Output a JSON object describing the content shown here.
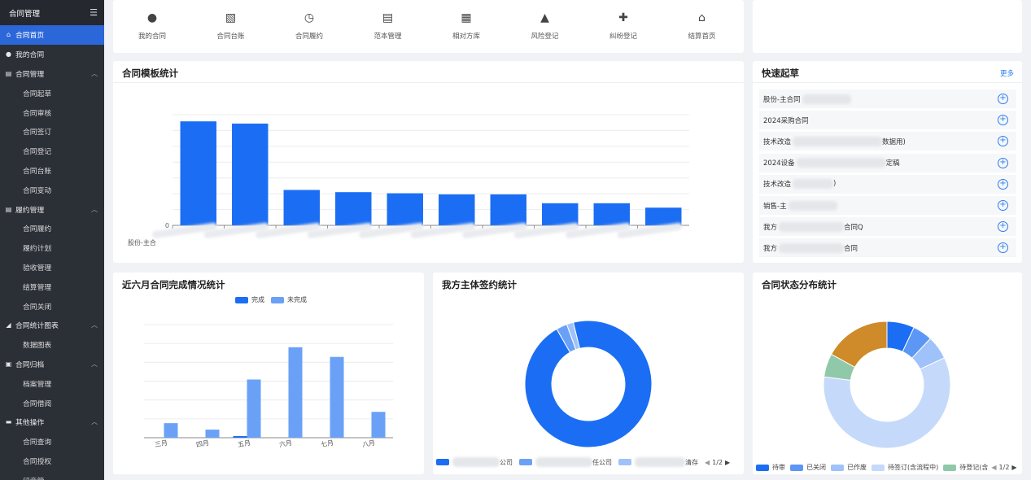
{
  "sidebar": {
    "title": "合同管理",
    "toggle_icon": "menu-fold-icon",
    "items": [
      {
        "label": "合同首页",
        "icon": "home-icon",
        "glyph": "⌂",
        "level": 1,
        "active": true
      },
      {
        "label": "我的合同",
        "icon": "user-icon",
        "glyph": "●",
        "level": 1
      },
      {
        "label": "合同管理",
        "icon": "doc-icon",
        "glyph": "▤",
        "level": 1,
        "expanded": true
      },
      {
        "label": "合同起草",
        "level": 2
      },
      {
        "label": "合同审核",
        "level": 2
      },
      {
        "label": "合同签订",
        "level": 2
      },
      {
        "label": "合同登记",
        "level": 2
      },
      {
        "label": "合同台账",
        "level": 2
      },
      {
        "label": "合同变动",
        "level": 2
      },
      {
        "label": "履约管理",
        "icon": "doc-icon",
        "glyph": "▤",
        "level": 1,
        "expanded": true
      },
      {
        "label": "合同履约",
        "level": 2
      },
      {
        "label": "履约计划",
        "level": 2
      },
      {
        "label": "验收管理",
        "level": 2
      },
      {
        "label": "结算管理",
        "level": 2
      },
      {
        "label": "合同关闭",
        "level": 2
      },
      {
        "label": "合同统计图表",
        "icon": "chart-icon",
        "glyph": "◢",
        "level": 1,
        "expanded": true
      },
      {
        "label": "数据图表",
        "level": 2
      },
      {
        "label": "合同归档",
        "icon": "archive-icon",
        "glyph": "▣",
        "level": 1,
        "expanded": true
      },
      {
        "label": "档案管理",
        "level": 2
      },
      {
        "label": "合同借阅",
        "level": 2
      },
      {
        "label": "其他操作",
        "icon": "monitor-icon",
        "glyph": "▬",
        "level": 1,
        "expanded": true
      },
      {
        "label": "合同查询",
        "level": 2
      },
      {
        "label": "合同授权",
        "level": 2
      },
      {
        "label": "印章管",
        "level": 2
      }
    ]
  },
  "quick_icons": [
    {
      "label": "我的合同",
      "icon": "user-icon",
      "glyph": "●"
    },
    {
      "label": "合同台账",
      "icon": "ledger-icon",
      "glyph": "▧"
    },
    {
      "label": "合同履约",
      "icon": "contract-clock-icon",
      "glyph": "◷"
    },
    {
      "label": "范本管理",
      "icon": "template-icon",
      "glyph": "▤"
    },
    {
      "label": "相对方库",
      "icon": "counterparty-icon",
      "glyph": "▦"
    },
    {
      "label": "风险登记",
      "icon": "alarm-icon",
      "glyph": "▲"
    },
    {
      "label": "纠纷登记",
      "icon": "file-plus-icon",
      "glyph": "✚"
    },
    {
      "label": "结算首页",
      "icon": "home-icon",
      "glyph": "⌂"
    }
  ],
  "template_stats": {
    "title": "合同模板统计",
    "ytick_label": "0",
    "xtick_prefix": "股份-主合",
    "chart_data": {
      "type": "bar",
      "title": "合同模板统计",
      "ylim": [
        0,
        100
      ],
      "values": [
        94,
        92,
        32,
        30,
        29,
        28,
        28,
        20,
        20,
        16
      ],
      "color": "#1b6ef3"
    }
  },
  "quick_draft": {
    "title": "快速起草",
    "more_label": "更多",
    "items": [
      {
        "pre": "股份-主合同",
        "post": ""
      },
      {
        "pre": "2024采购合同",
        "post": ""
      },
      {
        "pre": "技术改造",
        "post": "数据用)"
      },
      {
        "pre": "2024设备",
        "post": "定稿"
      },
      {
        "pre": "技术改造",
        "post": ")"
      },
      {
        "pre": "销售-主",
        "post": ""
      },
      {
        "pre": "我方",
        "post": "合同Q"
      },
      {
        "pre": "我方",
        "post": "合同"
      }
    ]
  },
  "completion": {
    "title": "近六月合同完成情况统计",
    "chart_data": {
      "type": "bar",
      "title": "近六月合同完成情况统计",
      "categories": [
        "三月",
        "四月",
        "五月",
        "六月",
        "七月",
        "八月"
      ],
      "ylim": [
        0,
        70
      ],
      "series": [
        {
          "name": "完成",
          "color": "#1b6ef3",
          "values": [
            0,
            0,
            1,
            0,
            0,
            0
          ]
        },
        {
          "name": "未完成",
          "color": "#6aa1f7",
          "values": [
            9,
            5,
            36,
            56,
            50,
            16
          ]
        }
      ]
    }
  },
  "subject_stats": {
    "title": "我方主体签约统计",
    "legend": [
      {
        "label": "公司",
        "color": "#1b6ef3"
      },
      {
        "label": "任公司",
        "color": "#6aa1f7"
      },
      {
        "label": "清存",
        "color": "#9fc2fa"
      }
    ],
    "pager": "1/2",
    "chart_data": {
      "type": "pie",
      "title": "我方主体签约统计",
      "values": [
        95.5,
        2.8,
        1.7
      ],
      "colors": [
        "#1b6ef3",
        "#6aa1f7",
        "#9fc2fa"
      ]
    }
  },
  "status_stats": {
    "title": "合同状态分布统计",
    "legend": [
      {
        "label": "待审",
        "color": "#1b6ef3"
      },
      {
        "label": "已关闭",
        "color": "#5d97f5"
      },
      {
        "label": "已作废",
        "color": "#9fc2fa"
      },
      {
        "label": "待签订(含流程中)",
        "color": "#c5d9fb"
      },
      {
        "label": "待登记(含",
        "color": "#8fc9aa"
      }
    ],
    "pager": "1/2",
    "chart_data": {
      "type": "pie",
      "title": "合同状态分布统计",
      "categories": [
        "待审",
        "已关闭",
        "已作废",
        "待签订(含流程中)",
        "待登记(含",
        "其他"
      ],
      "values": [
        7,
        5,
        6,
        59,
        6,
        17
      ],
      "colors": [
        "#1b6ef3",
        "#5d97f5",
        "#9fc2fa",
        "#c5d9fb",
        "#8fc9aa",
        "#cf8a2a"
      ]
    }
  }
}
